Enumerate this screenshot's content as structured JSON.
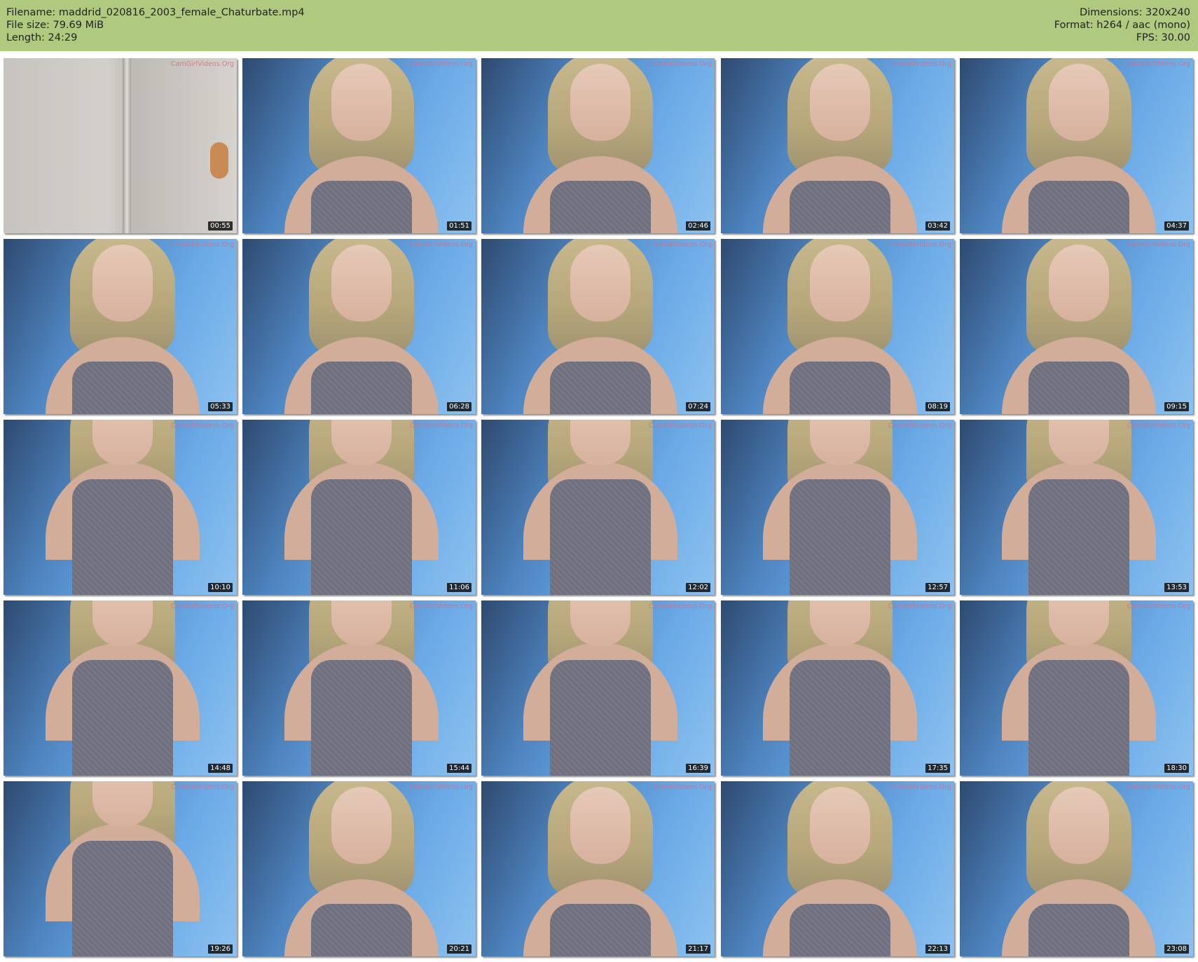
{
  "header": {
    "filename": "Filename: maddrid_020816_2003_female_Chaturbate.mp4",
    "filesize": "File size: 79.69 MiB",
    "length": "Length: 24:29",
    "dimensions": "Dimensions: 320x240",
    "format": "Format: h264 / aac (mono)",
    "fps": "FPS: 30.00"
  },
  "watermark": "CamGirlVideos.Org",
  "thumbnails": [
    {
      "time": "00:55"
    },
    {
      "time": "01:51"
    },
    {
      "time": "02:46"
    },
    {
      "time": "03:42"
    },
    {
      "time": "04:37"
    },
    {
      "time": "05:33"
    },
    {
      "time": "06:28"
    },
    {
      "time": "07:24"
    },
    {
      "time": "08:19"
    },
    {
      "time": "09:15"
    },
    {
      "time": "10:10"
    },
    {
      "time": "11:06"
    },
    {
      "time": "12:02"
    },
    {
      "time": "12:57"
    },
    {
      "time": "13:53"
    },
    {
      "time": "14:48"
    },
    {
      "time": "15:44"
    },
    {
      "time": "16:39"
    },
    {
      "time": "17:35"
    },
    {
      "time": "18:30"
    },
    {
      "time": "19:26"
    },
    {
      "time": "20:21"
    },
    {
      "time": "21:17"
    },
    {
      "time": "22:13"
    },
    {
      "time": "23:08"
    }
  ]
}
